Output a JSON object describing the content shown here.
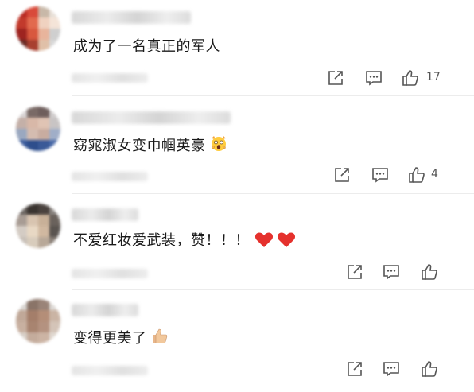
{
  "comments": [
    {
      "text": "成为了一名真正的军人",
      "likes": "17"
    },
    {
      "text": "窈窕淑女变巾帼英豪",
      "likes": "4"
    },
    {
      "text": "不爱红妆爱武装，赞！！！",
      "likes": ""
    },
    {
      "text": "变得更美了",
      "likes": ""
    }
  ],
  "icons": {
    "share": "share-icon",
    "reply": "reply-icon",
    "like": "thumbs-up-icon"
  },
  "colors": {
    "text": "#1a1a1a",
    "icon": "#555555",
    "heart": "#e5312d"
  }
}
